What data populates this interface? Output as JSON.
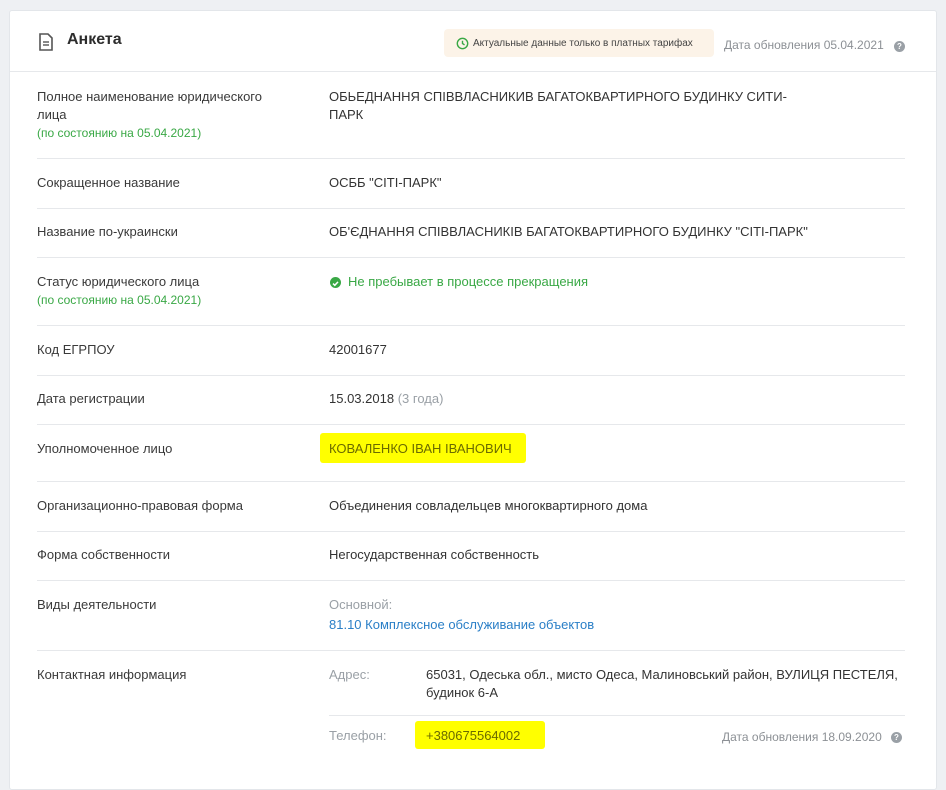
{
  "header": {
    "title": "Анкета",
    "badge": "Актуальные данные только в платных тарифах",
    "update": "Дата обновления 05.04.2021"
  },
  "rows": {
    "full_name": {
      "label1": "Полное наименование юридического",
      "label2": "лица",
      "sub": "(по состоянию на 05.04.2021)",
      "value1": "ОБЬЕДНАННЯ СПІВВЛАСНИКИВ БАГАТОКВАРТИРНОГО БУДИНКУ СИТИ-",
      "value2": "ПАРК"
    },
    "short_name": {
      "label": "Сокращенное название",
      "value": "ОСББ \"СІТІ-ПАРК\""
    },
    "ua_name": {
      "label": "Название по-украински",
      "value": "ОБ'ЄДНАННЯ СПІВВЛАСНИКІВ БАГАТОКВАРТИРНОГО БУДИНКУ \"СІТІ-ПАРК\""
    },
    "status": {
      "label": "Статус юридического лица",
      "sub": "(по состоянию на 05.04.2021)",
      "value": "Не пребывает в процессе прекращения"
    },
    "code": {
      "label": "Код ЕГРПОУ",
      "value": "42001677"
    },
    "reg_date": {
      "label": "Дата регистрации",
      "value": "15.03.2018",
      "age": "(3 года)"
    },
    "authorized": {
      "label": "Уполномоченное лицо",
      "value": "КОВАЛЕНКО ІВАН ІВАНОВИЧ"
    },
    "legal_form": {
      "label": "Организационно-правовая форма",
      "value": "Объединения совладельцев многоквартирного дома"
    },
    "ownership": {
      "label": "Форма собственности",
      "value": "Негосударственная собственность"
    },
    "activity": {
      "label": "Виды деятельности",
      "main_label": "Основной:",
      "main_value": "81.10 Комплексное обслуживание объектов"
    },
    "contact": {
      "label": "Контактная информация",
      "address_label": "Адрес:",
      "address1": "65031, Одеська обл., мисто Одеса, Малиновський район, ВУЛИЦЯ ПЕСТЕЛЯ,",
      "address2": "будинок 6-А",
      "phone_label": "Телефон:",
      "phone": "+380675564002",
      "phone_update": "Дата обновления 18.09.2020"
    }
  },
  "colors": {
    "accent_green": "#39a845",
    "link_blue": "#2a7fc7",
    "highlight": "#ffff00"
  }
}
